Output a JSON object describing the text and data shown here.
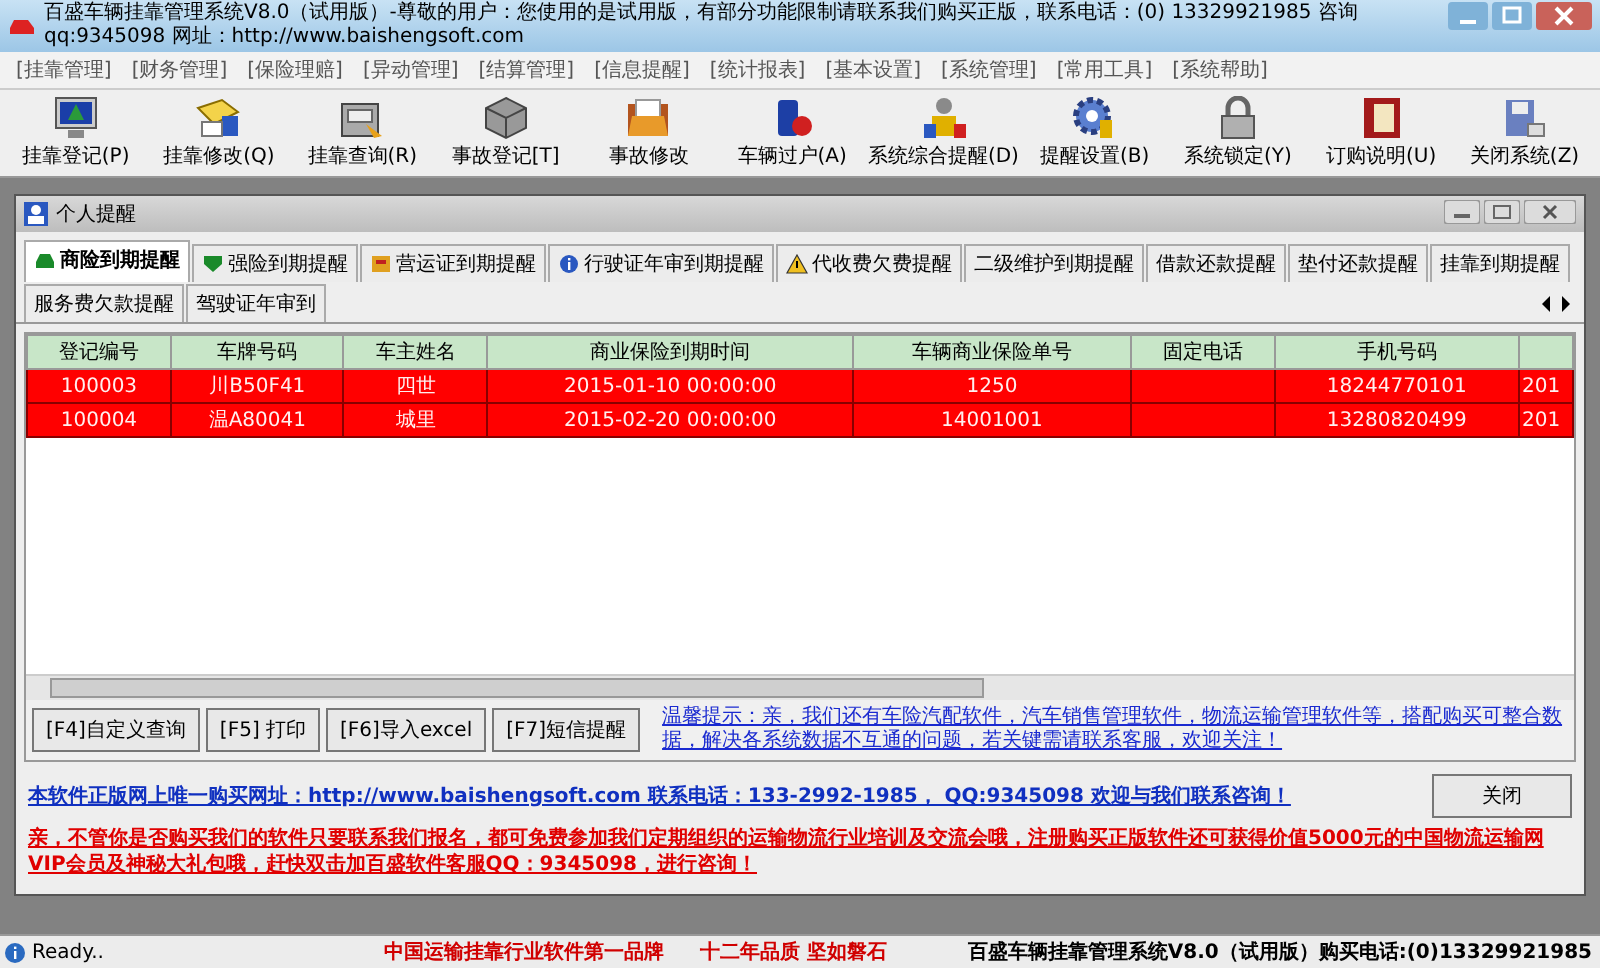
{
  "window": {
    "title": "百盛车辆挂靠管理系统V8.0（试用版）-尊敬的用户：您使用的是试用版，有部分功能限制请联系我们购买正版，联系电话：(0) 13329921985  咨询qq:9345098   网址：http://www.baishengsoft.com"
  },
  "menu": [
    "[挂靠管理]",
    "[财务管理]",
    "[保险理赔]",
    "[异动管理]",
    "[结算管理]",
    "[信息提醒]",
    "[统计报表]",
    "[基本设置]",
    "[系统管理]",
    "[常用工具]",
    "[系统帮助]"
  ],
  "toolbar": [
    {
      "label": "挂靠登记(P)",
      "kind": "monitor"
    },
    {
      "label": "挂靠修改(Q)",
      "kind": "notebook"
    },
    {
      "label": "挂靠查询(R)",
      "kind": "cabinet"
    },
    {
      "label": "事故登记[T]",
      "kind": "cube"
    },
    {
      "label": "事故修改",
      "kind": "folder"
    },
    {
      "label": "车辆过户(A)",
      "kind": "bottle"
    },
    {
      "label": "系统综合提醒(D)",
      "kind": "people"
    },
    {
      "label": "提醒设置(B)",
      "kind": "gear"
    },
    {
      "label": "系统锁定(Y)",
      "kind": "lock"
    },
    {
      "label": "订购说明(U)",
      "kind": "book"
    },
    {
      "label": "关闭系统(Z)",
      "kind": "disk"
    }
  ],
  "dialog": {
    "title": "个人提醒",
    "tabs": [
      {
        "label": "商险到期提醒",
        "selected": true,
        "kind": "car"
      },
      {
        "label": "强险到期提醒",
        "selected": false,
        "kind": "shield"
      },
      {
        "label": "营运证到期提醒",
        "selected": false,
        "kind": "card"
      },
      {
        "label": "行驶证年审到期提醒",
        "selected": false,
        "kind": "info"
      },
      {
        "label": "代收费欠费提醒",
        "selected": false,
        "kind": "warning"
      },
      {
        "label": "二级维护到期提醒",
        "selected": false
      },
      {
        "label": "借款还款提醒",
        "selected": false
      },
      {
        "label": "垫付还款提醒",
        "selected": false
      },
      {
        "label": "挂靠到期提醒",
        "selected": false
      },
      {
        "label": "服务费欠款提醒",
        "selected": false
      },
      {
        "label": "驾驶证年审到",
        "selected": false
      }
    ],
    "table": {
      "columns": [
        "登记编号",
        "车牌号码",
        "车主姓名",
        "商业保险到期时间",
        "车辆商业保险单号",
        "固定电话",
        "手机号码"
      ],
      "rows": [
        [
          "100003",
          "川B50F41",
          "四世",
          "2015-01-10 00:00:00",
          "1250",
          "",
          "18244770101",
          "201"
        ],
        [
          "100004",
          "温A80041",
          "城里",
          "2015-02-20 00:00:00",
          "14001001",
          "",
          "13280820499",
          "201"
        ]
      ]
    },
    "buttons": [
      "[F4]自定义查询",
      "[F5] 打印",
      "[F6]导入excel",
      "[F7]短信提醒"
    ],
    "hint": "温馨提示：亲，我们还有车险汽配软件，汽车销售管理软件，物流运输管理软件等，搭配购买可整合数据，解决各系统数据不互通的问题，若关键需请联系客服，欢迎关注！",
    "info": "本软件正版网上唯一购买网址：http://www.baishengsoft.com   联系电话：133-2992-1985， QQ:9345098 欢迎与我们联系咨询！",
    "close_button": "关闭",
    "notice": "亲，不管你是否购买我们的软件只要联系我们报名，都可免费参加我们定期组织的运输物流行业培训及交流会哦，注册购买正版软件还可获得价值5000元的中国物流运输网VIP会员及神秘大礼包哦，赶快双击加百盛软件客服QQ：9345098，进行咨询！"
  },
  "status_bar": {
    "status": "Ready..",
    "slogan": "中国运输挂靠行业软件第一品牌",
    "motto": "十二年品质 坚如磐石",
    "product": "百盛车辆挂靠管理系统V8.0（试用版）购买电话:(0)13329921985"
  }
}
